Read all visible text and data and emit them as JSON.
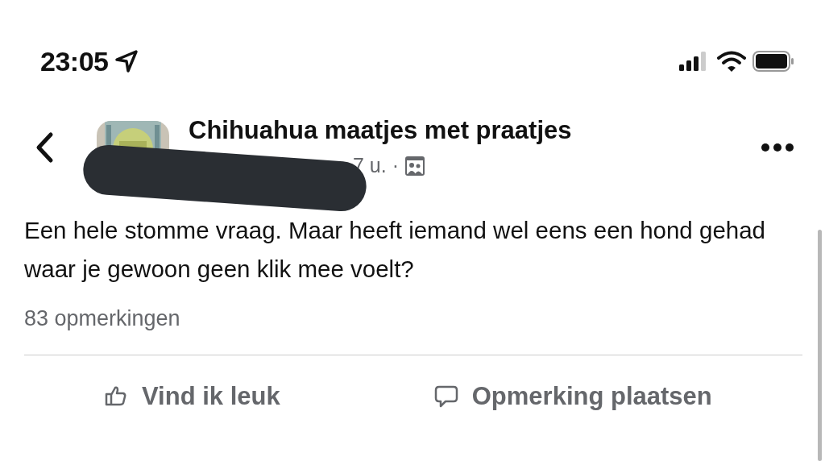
{
  "status_bar": {
    "time": "23:05"
  },
  "post_header": {
    "group_name": "Chihuahua maatjes met praatjes",
    "meta": "7 u. ·"
  },
  "post": {
    "text": "Een hele stomme vraag. Maar heeft iemand wel eens een hond gehad waar je gewoon geen klik mee voelt?",
    "comment_count": "83 opmerkingen"
  },
  "actions": [
    {
      "kind": "like",
      "label": "Vind ik leuk"
    },
    {
      "kind": "comment",
      "label": "Opmerking plaatsen"
    }
  ]
}
